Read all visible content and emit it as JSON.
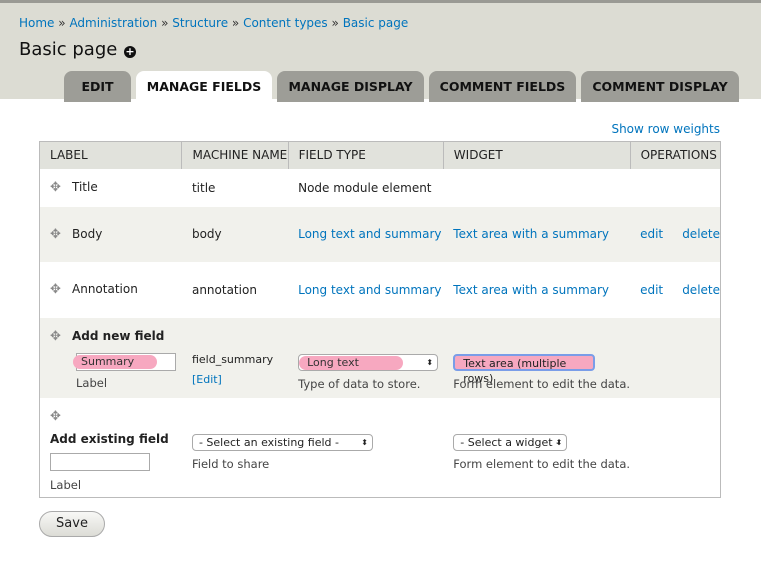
{
  "breadcrumb": [
    "Home",
    "Administration",
    "Structure",
    "Content types",
    "Basic page"
  ],
  "breadcrumb_sep": "»",
  "page_title": "Basic page",
  "tabs": [
    "EDIT",
    "MANAGE FIELDS",
    "MANAGE DISPLAY",
    "COMMENT FIELDS",
    "COMMENT DISPLAY"
  ],
  "active_tab": "MANAGE FIELDS",
  "show_row_weights": "Show row weights",
  "columns": [
    "LABEL",
    "MACHINE NAME",
    "FIELD TYPE",
    "WIDGET",
    "OPERATIONS"
  ],
  "rows": [
    {
      "label": "Title",
      "machine": "title",
      "type": "Node module element",
      "widget": "",
      "edit": "",
      "delete": ""
    },
    {
      "label": "Body",
      "machine": "body",
      "type": "Long text and summary",
      "widget": "Text area with a summary",
      "edit": "edit",
      "delete": "delete"
    },
    {
      "label": "Annotation",
      "machine": "annotation",
      "type": "Long text and summary",
      "widget": "Text area with a summary",
      "edit": "edit",
      "delete": "delete"
    }
  ],
  "add_new": {
    "heading": "Add new field",
    "label_value": "Summary",
    "label_caption": "Label",
    "machine": "field_summary",
    "edit_link": "[Edit]",
    "type_value": "Long text",
    "type_desc": "Type of data to store.",
    "widget_value": "Text area (multiple rows)",
    "widget_desc": "Form element to edit the data."
  },
  "add_existing": {
    "heading": "Add existing field",
    "label_value": "",
    "label_caption": "Label",
    "field_placeholder": "- Select an existing field -",
    "field_desc": "Field to share",
    "widget_placeholder": "- Select a widget -",
    "widget_desc": "Form element to edit the data."
  },
  "save": "Save",
  "highlight_color": "#f7a8c0"
}
